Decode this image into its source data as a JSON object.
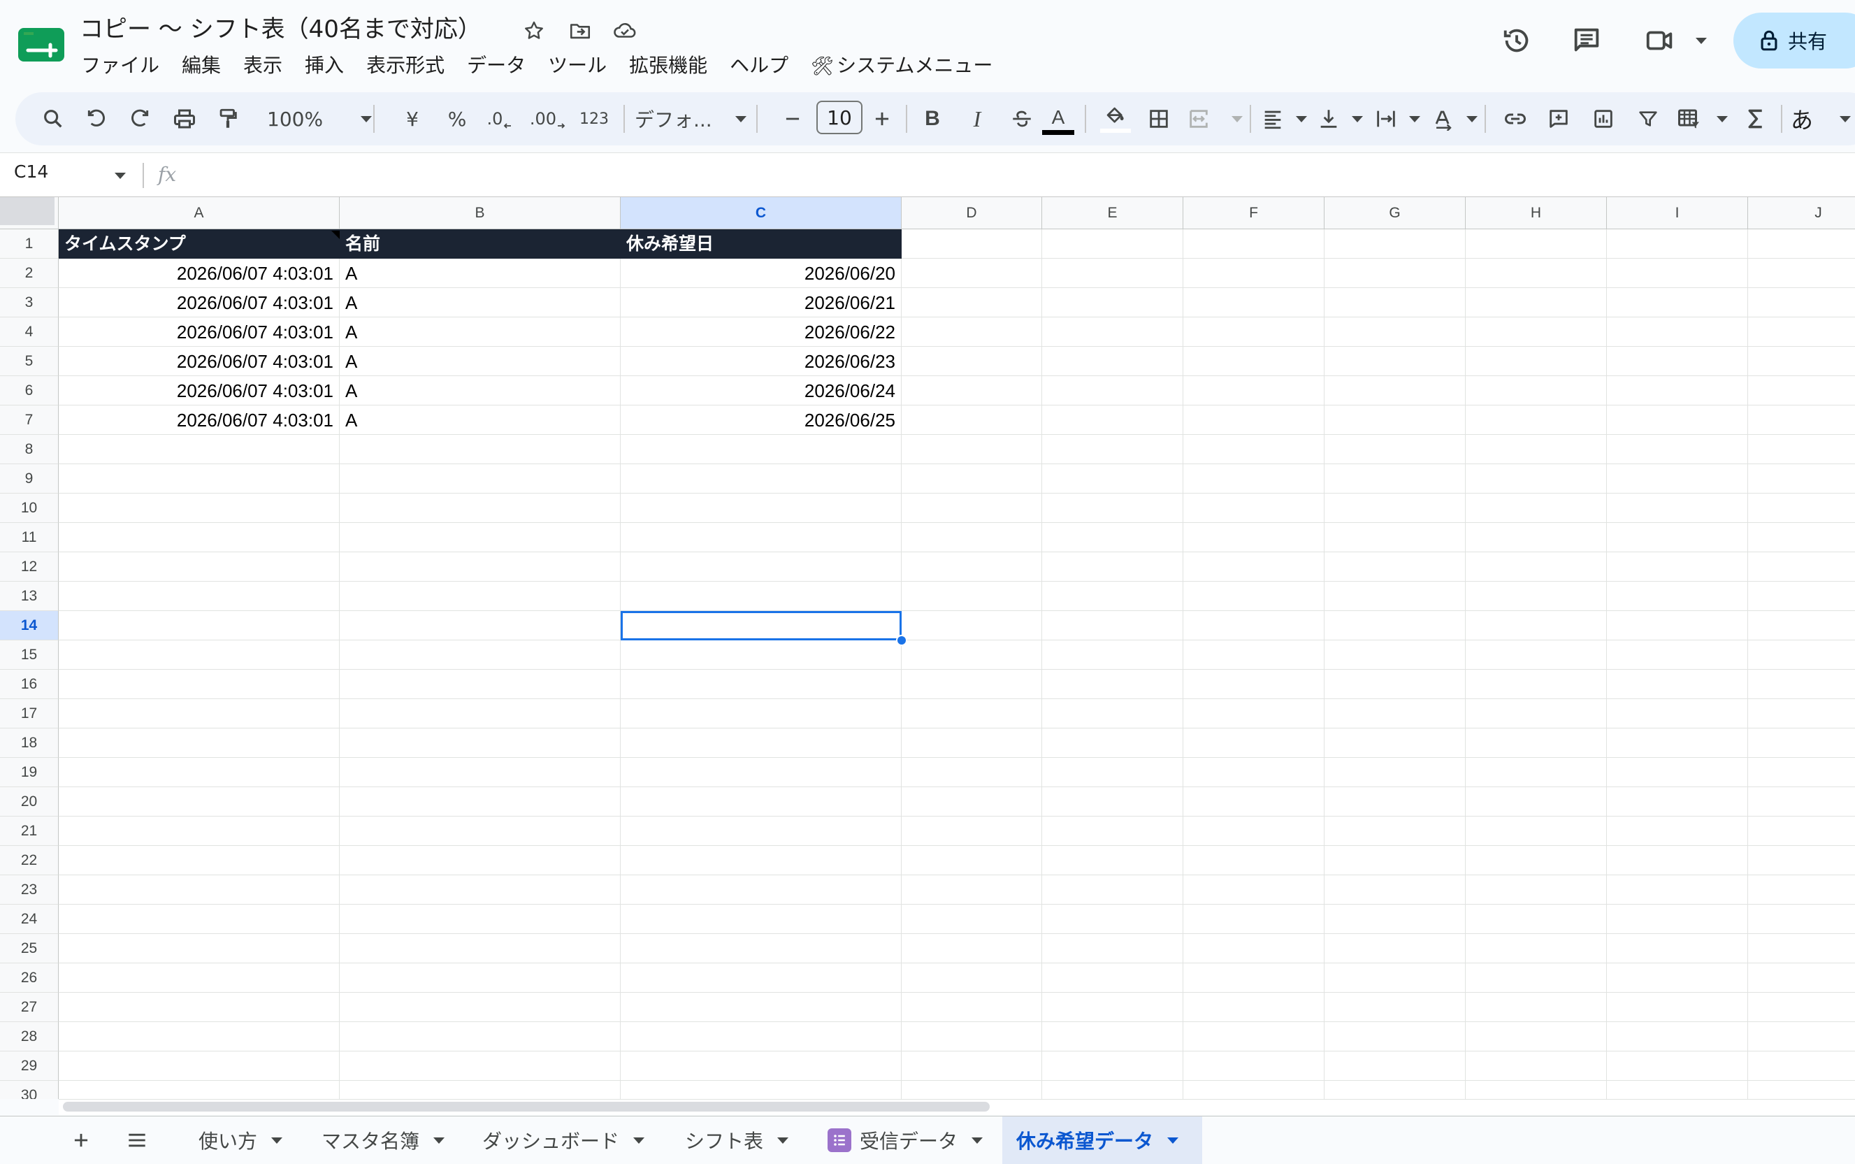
{
  "document": {
    "title": "コピー 〜 シフト表（40名まで対応）"
  },
  "menu": [
    "ファイル",
    "編集",
    "表示",
    "挿入",
    "表示形式",
    "データ",
    "ツール",
    "拡張機能",
    "ヘルプ"
  ],
  "custom_menu": {
    "emoji": "🛠",
    "label": "システムメニュー"
  },
  "share": {
    "label": "共有"
  },
  "toolbar": {
    "zoom": "100%",
    "currency": "¥",
    "percent": "%",
    "decrease_decimal": ".0",
    "increase_decimal": ".00",
    "number_format": "123",
    "font": "デフォ...",
    "font_size": "10",
    "bold": "B",
    "italic": "I",
    "text_color": "A",
    "ime": "あ"
  },
  "formula_bar": {
    "name_box": "C14",
    "fx": "fx",
    "formula": ""
  },
  "columns": [
    "A",
    "B",
    "C",
    "D",
    "E",
    "F",
    "G",
    "H",
    "I",
    "J"
  ],
  "rows": [
    "1",
    "2",
    "3",
    "4",
    "5",
    "6",
    "7",
    "8",
    "9",
    "10",
    "11",
    "12",
    "13",
    "14",
    "15",
    "16",
    "17",
    "18",
    "19",
    "20",
    "21",
    "22",
    "23",
    "24",
    "25",
    "26",
    "27",
    "28",
    "29",
    "30"
  ],
  "active_cell": {
    "column": "C",
    "row": "14"
  },
  "sheet": {
    "headers": [
      "タイムスタンプ",
      "名前",
      "休み希望日"
    ],
    "records": [
      [
        "2026/06/07 4:03:01",
        "A",
        "2026/06/20"
      ],
      [
        "2026/06/07 4:03:01",
        "A",
        "2026/06/21"
      ],
      [
        "2026/06/07 4:03:01",
        "A",
        "2026/06/22"
      ],
      [
        "2026/06/07 4:03:01",
        "A",
        "2026/06/23"
      ],
      [
        "2026/06/07 4:03:01",
        "A",
        "2026/06/24"
      ],
      [
        "2026/06/07 4:03:01",
        "A",
        "2026/06/25"
      ]
    ]
  },
  "sheet_tabs": [
    {
      "label": "使い方",
      "active": false
    },
    {
      "label": "マスタ名簿",
      "active": false
    },
    {
      "label": "ダッシュボード",
      "active": false
    },
    {
      "label": "シフト表",
      "active": false
    },
    {
      "label": "受信データ",
      "active": false,
      "icon": "form-icon"
    },
    {
      "label": "休み希望データ",
      "active": true
    }
  ],
  "colors": {
    "accent": "#0b57d0",
    "header_row_bg": "#1b2433",
    "share_bg": "#c2e7ff",
    "selection": "#1a73e8"
  }
}
